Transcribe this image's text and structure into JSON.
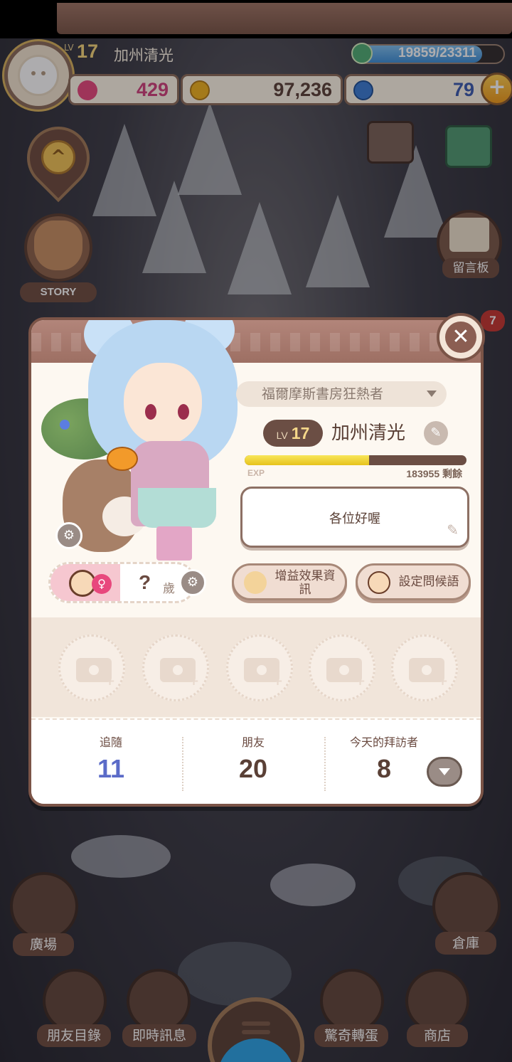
{
  "hud": {
    "level_prefix": "LV",
    "level": "17",
    "player_name": "加州清光",
    "exp_text": "19859/23311",
    "exp_fraction": 0.852,
    "hearts": "429",
    "gold": "97,236",
    "gems": "79",
    "plus": "+"
  },
  "side": {
    "story_label": "STORY",
    "board_label": "留言板",
    "notification_count": "7"
  },
  "profile": {
    "title": "福爾摩斯書房狂熱者",
    "level_prefix": "LV",
    "level": "17",
    "name": "加州清光",
    "exp_label": "EXP",
    "exp_fraction": 0.56,
    "exp_remaining": "183955 剩餘",
    "greeting": "各位好喔",
    "age_value": "?",
    "age_unit": "歲",
    "buff_button": "增益效果資訊",
    "greeting_button": "設定問候語",
    "close": "✕",
    "stats": [
      {
        "label": "追隨",
        "value": "11",
        "color": "#5b6bc8"
      },
      {
        "label": "朋友",
        "value": "20",
        "color": "#5a4036"
      },
      {
        "label": "今天的拜訪者",
        "value": "8",
        "color": "#5a4036"
      }
    ]
  },
  "nav": {
    "plaza": "廣場",
    "warehouse": "倉庫",
    "friends_list": "朋友目錄",
    "messages": "即時訊息",
    "gacha": "驚奇轉蛋",
    "shop": "商店"
  },
  "colors": {
    "heart": "#e8487d",
    "gold": "#f2b21c",
    "gem": "#3a7bd5",
    "follow_value": "#5b6bc8"
  }
}
